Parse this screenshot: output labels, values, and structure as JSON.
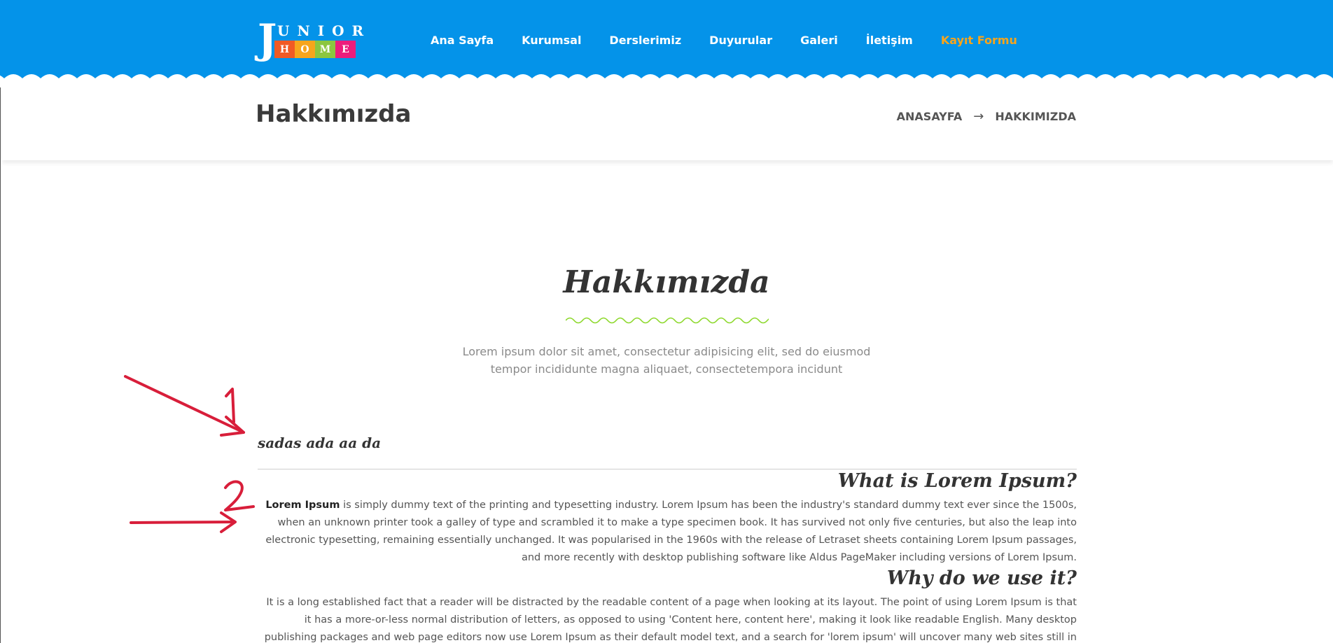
{
  "colors": {
    "header": "#0493e9",
    "accent_nav": "#f7a51c",
    "squiggle": "#8cd82a",
    "annotation": "#d81e3a"
  },
  "logo": {
    "letter": "J",
    "top": "UNIOR",
    "tiles": [
      {
        "char": "H",
        "color": "#f15a24"
      },
      {
        "char": "O",
        "color": "#f7a51c"
      },
      {
        "char": "M",
        "color": "#8cc63f"
      },
      {
        "char": "E",
        "color": "#ec1c7c"
      }
    ]
  },
  "nav": [
    "Ana Sayfa",
    "Kurumsal",
    "Derslerimiz",
    "Duyurular",
    "Galeri",
    "İletişim",
    "Kayıt Formu"
  ],
  "page": {
    "title": "Hakkımızda"
  },
  "breadcrumb": {
    "home": "ANASAYFA",
    "arrow": "→",
    "current": "HAKKIMIZDA"
  },
  "section": {
    "title": "Hakkımızda",
    "lead": "Lorem ipsum dolor sit amet, consectetur adipisicing elit, sed do eiusmod tempor incididunte magna aliquaet, consectetempora incidunt"
  },
  "content": {
    "small_heading": "sadas ada aa da",
    "h1": "What is Lorem Ipsum?",
    "p1_bold": "Lorem Ipsum",
    "p1": " is simply dummy text of the printing and typesetting industry. Lorem Ipsum has been the industry's standard dummy text ever since the 1500s, when an unknown printer took a galley of type and scrambled it to make a type specimen book. It has survived not only five centuries, but also the leap into electronic typesetting, remaining essentially unchanged. It was popularised in the 1960s with the release of Letraset sheets containing Lorem Ipsum passages, and more recently with desktop publishing software like Aldus PageMaker including versions of Lorem Ipsum.",
    "h2": "Why do we use it?",
    "p2": "It is a long established fact that a reader will be distracted by the readable content of a page when looking at its layout. The point of using Lorem Ipsum is that it has a more-or-less normal distribution of letters, as opposed to using 'Content here, content here', making it look like readable English. Many desktop publishing packages and web page editors now use Lorem Ipsum as their default model text, and a search for 'lorem ipsum' will uncover many web sites still in their infancy. Various versions have evolved over the years,"
  },
  "annotations": {
    "one": "1",
    "two": "2"
  }
}
